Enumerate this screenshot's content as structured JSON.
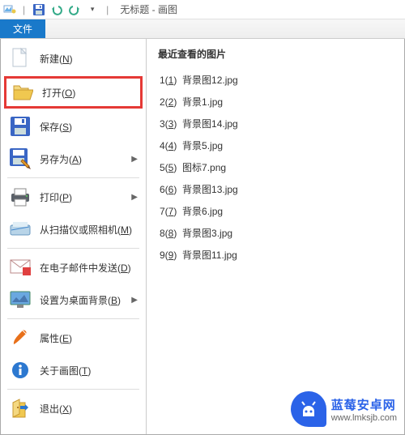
{
  "title": {
    "app_name": "画图",
    "doc_name": "无标题"
  },
  "qat": {
    "sep": "|"
  },
  "file_tab": {
    "label": "文件"
  },
  "menu": {
    "new": "新建(N)",
    "open": "打开(O)",
    "save": "保存(S)",
    "save_as": "另存为(A)",
    "print": "打印(P)",
    "from_scanner": "从扫描仪或照相机(M)",
    "send_email": "在电子邮件中发送(D)",
    "set_wallpaper": "设置为桌面背景(B)",
    "properties": "属性(E)",
    "about": "关于画图(T)",
    "exit": "退出(X)"
  },
  "recent": {
    "header": "最近查看的图片",
    "items": [
      {
        "n": "1",
        "u": "1",
        "name": "背景图12.jpg"
      },
      {
        "n": "2",
        "u": "2",
        "name": "背景1.jpg"
      },
      {
        "n": "3",
        "u": "3",
        "name": "背景图14.jpg"
      },
      {
        "n": "4",
        "u": "4",
        "name": "背景5.jpg"
      },
      {
        "n": "5",
        "u": "5",
        "name": "图标7.png"
      },
      {
        "n": "6",
        "u": "6",
        "name": "背景图13.jpg"
      },
      {
        "n": "7",
        "u": "7",
        "name": "背景6.jpg"
      },
      {
        "n": "8",
        "u": "8",
        "name": "背景图3.jpg"
      },
      {
        "n": "9",
        "u": "9",
        "name": "背景图11.jpg"
      }
    ]
  },
  "watermark": {
    "title": "蓝莓安卓网",
    "url": "www.lmksjb.com"
  }
}
